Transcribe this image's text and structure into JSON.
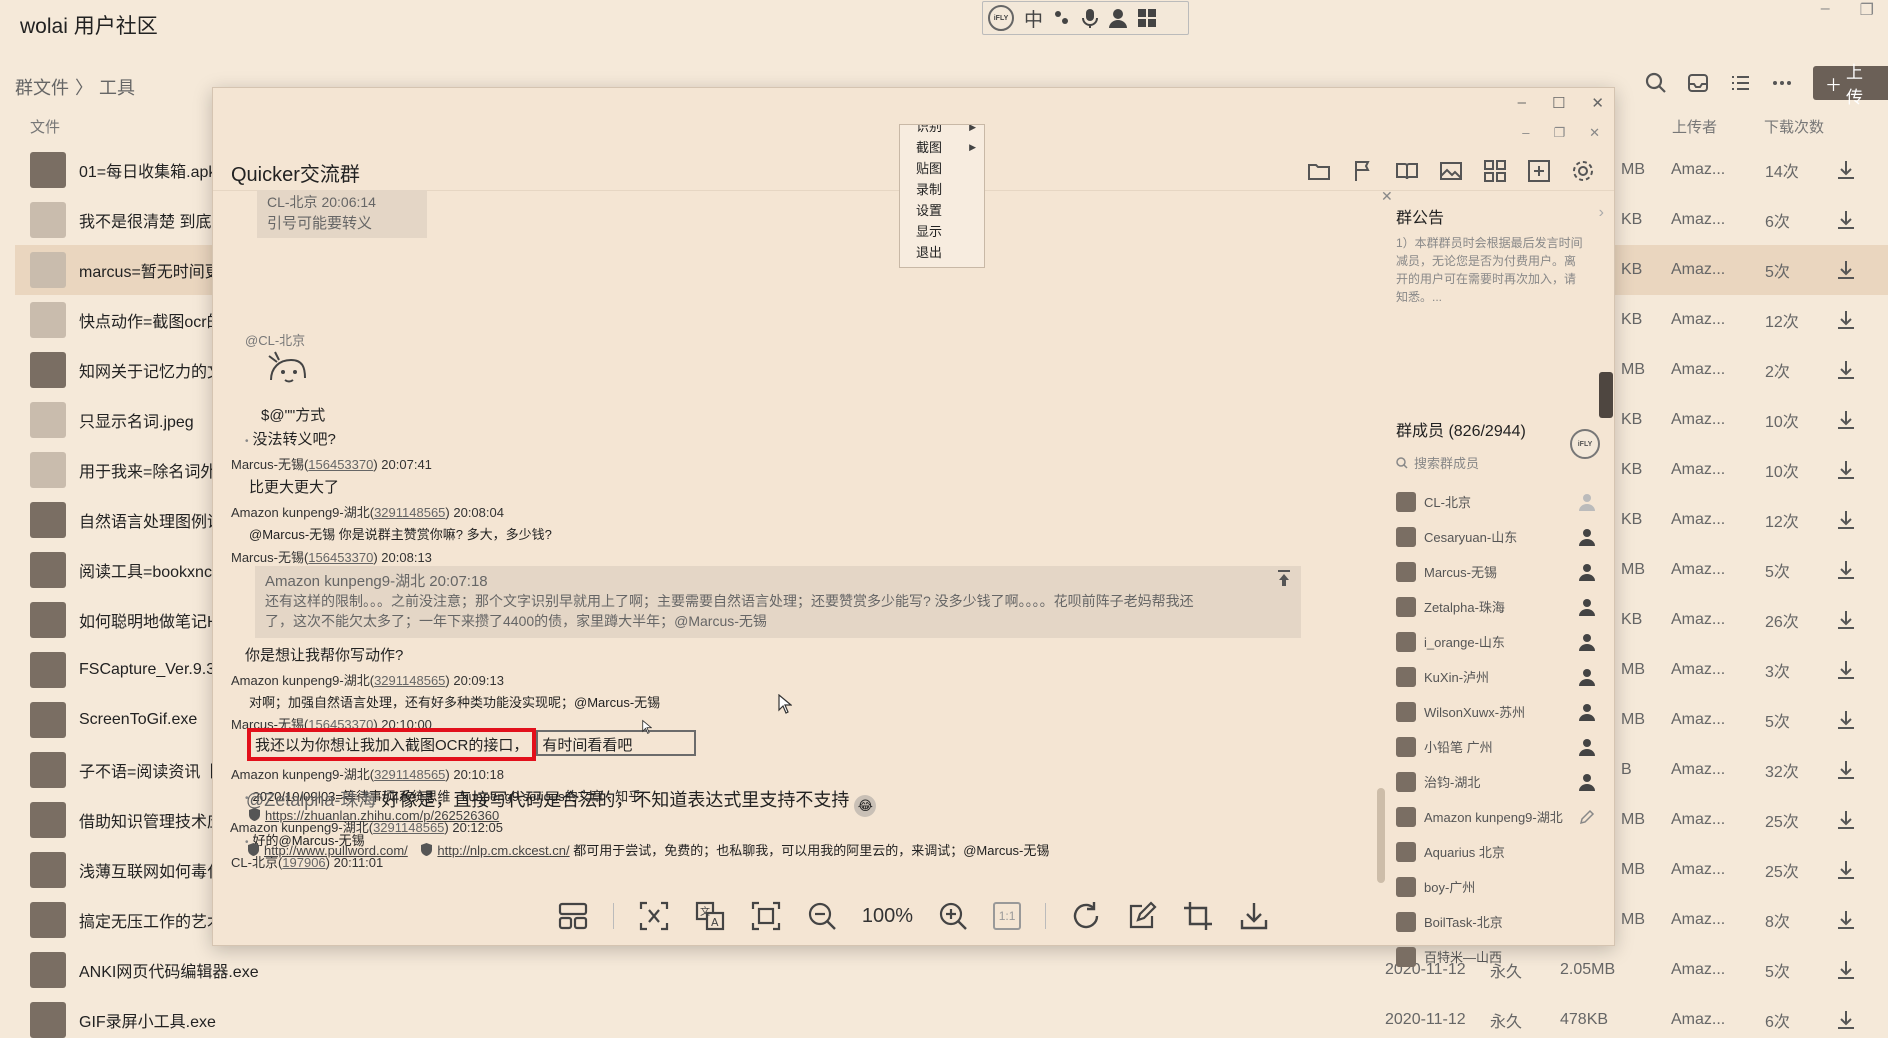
{
  "app": {
    "title": "wolai 用户社区"
  },
  "ime": {
    "logo": "iFLY",
    "mode": "中"
  },
  "breadcrumb": {
    "root": "群文件",
    "sep": "〉",
    "current": "工具"
  },
  "toolbar": {
    "upload_label": "上传"
  },
  "columns": {
    "file": "文件",
    "uploader": "上传者",
    "downloads": "下载次数"
  },
  "files": [
    {
      "name": "01=每日收集箱.apk",
      "size": "MB",
      "uploader": "Amaz...",
      "downloads": "14次"
    },
    {
      "name": "我不是很清楚 到底多",
      "size": "KB",
      "uploader": "Amaz...",
      "downloads": "6次"
    },
    {
      "name": "marcus=暂无时间更",
      "size": "KB",
      "uploader": "Amaz...",
      "downloads": "5次"
    },
    {
      "name": "快点动作=截图ocr的",
      "size": "KB",
      "uploader": "Amaz...",
      "downloads": "12次"
    },
    {
      "name": "知网关于记忆力的文",
      "size": "MB",
      "uploader": "Amaz...",
      "downloads": "2次"
    },
    {
      "name": "只显示名词.jpeg",
      "size": "KB",
      "uploader": "Amaz...",
      "downloads": "10次"
    },
    {
      "name": "用于我来=除名词外",
      "size": "KB",
      "uploader": "Amaz...",
      "downloads": "10次"
    },
    {
      "name": "自然语言处理图例说",
      "size": "KB",
      "uploader": "Amaz...",
      "downloads": "12次"
    },
    {
      "name": "阅读工具=bookxnc",
      "size": "MB",
      "uploader": "Amaz...",
      "downloads": "5次"
    },
    {
      "name": "如何聪明地做笔记H",
      "size": "KB",
      "uploader": "Amaz...",
      "downloads": "26次"
    },
    {
      "name": "FSCapture_Ver.9.3_",
      "size": "MB",
      "uploader": "Amaz...",
      "downloads": "3次"
    },
    {
      "name": "ScreenToGif.exe",
      "size": "MB",
      "uploader": "Amaz...",
      "downloads": "5次"
    },
    {
      "name": "子不语=阅读资讯【(",
      "size": "B",
      "uploader": "Amaz...",
      "downloads": "32次"
    },
    {
      "name": "借助知识管理技术应",
      "size": "MB",
      "uploader": "Amaz...",
      "downloads": "25次"
    },
    {
      "name": "浅薄互联网如何毒化",
      "size": "MB",
      "uploader": "Amaz...",
      "downloads": "25次"
    },
    {
      "name": "搞定无压工作的艺术",
      "size": "MB",
      "uploader": "Amaz...",
      "downloads": "8次"
    },
    {
      "name": "ANKI网页代码编辑器.exe",
      "date": "2020-11-12",
      "expiry": "永久",
      "size": "2.05MB",
      "uploader": "Amaz...",
      "downloads": "5次"
    },
    {
      "name": "GIF录屏小工具.exe",
      "date": "2020-11-12",
      "expiry": "永久",
      "size": "478KB",
      "uploader": "Amaz...",
      "downloads": "6次"
    }
  ],
  "viewer": {
    "group_title": "Quicker交流群",
    "zoom": "100%",
    "ratio_label": "1:1",
    "context_menu": [
      "识别",
      "截图",
      "贴图",
      "录制",
      "设置",
      "显示",
      "退出"
    ],
    "chat": {
      "q1_head": "CL-北京    20:06:14",
      "q1_text": "引号可能要转义",
      "m1_at": "@CL-北京",
      "m1_text": "$@\"\"方式",
      "m2_text": "没法转义吧?",
      "s1_name": "Marcus-无锡(",
      "s1_id": "156453370",
      "s1_time": ")  20:07:41",
      "m3_text": "比更大更大了",
      "s2_name": "Amazon kunpeng9-湖北(",
      "s2_id": "3291148565",
      "s2_time": ")  20:08:04",
      "m4_text": "@Marcus-无锡 你是说群主赞赏你嘛? 多大，多少钱?",
      "s3_name": "Marcus-无锡(",
      "s3_id": "156453370",
      "s3_time": ")  20:08:13",
      "q2_head": "Amazon kunpeng9-湖北    20:07:18",
      "q2_text1": "还有这样的限制。。。之前没注意；那个文字识别早就用上了啊；主要需要自然语言处理；还要赞赏多少能写? 没多少钱了啊。。。。花呗前阵子老妈帮我还",
      "q2_text2": "了，这次不能欠太多了；一年下来攒了4400的债，家里蹲大半年；@Marcus-无锡",
      "m5_text": "你是想让我帮你写动作?",
      "s4_name": "Amazon kunpeng9-湖北(",
      "s4_id": "3291148565",
      "s4_time": ")  20:09:13",
      "m6_text": "对啊；加强自然语言处理，还有好多种类功能没实现呢；@Marcus-无锡",
      "s5_name": "Marcus-无锡(",
      "s5_id": "156453370",
      "s5_time": ")  20:10:00",
      "m7_red": "我还以为你想让我加入截图OCR的接口，",
      "m7_gray": "有时间看看吧",
      "s6_name": "Amazon kunpeng9-湖北(",
      "s6_id": "3291148565",
      "s6_time": ")  20:10:18",
      "m8_text": "2020/10/09|03=等待事项|系统思维 - kunpeng9.serious的文章 - 知乎",
      "m8_link": "https://zhuanlan.zhihu.com/p/262526360",
      "m9_text": "好的@Marcus-无锡",
      "s7_name": "CL-北京(",
      "s7_id": "197906",
      "s7_time": ")  20:11:01",
      "m10_at": "@Zetalpha-珠海",
      "m10_text": " 好像是，直接写代码是合法的，不知道表达式里支持不支持",
      "s8_name": "Amazon kunpeng9-湖北(",
      "s8_id": "3291148565",
      "s8_time": ")  20:12:05",
      "m11_link1": "http://www.pullword.com/",
      "m11_link2": "http://nlp.cm.ckcest.cn/",
      "m11_text": " 都可用于尝试，免费的；也私聊我，可以用我的阿里云的，来调试；@Marcus-无锡"
    },
    "side": {
      "notice_title": "群公告",
      "notice_text": "1）本群群员时会根据最后发言时间减员，无论您是否为付费用户。离开的用户可在需要时再次加入，请知悉。...",
      "members_title": "群成员 (826/2944)",
      "search_placeholder": "搜索群成员",
      "members": [
        "CL-北京",
        "Cesaryuan-山东",
        "Marcus-无锡",
        "Zetalpha-珠海",
        "i_orange-山东",
        "KuXin-泸州",
        "WilsonXuwx-苏州",
        "小铅笔 广州",
        "治钧-湖北",
        "Amazon kunpeng9-湖北",
        "Aquarius 北京",
        "boy-广州",
        "BoilTask-北京",
        "百特米—山西"
      ]
    }
  }
}
